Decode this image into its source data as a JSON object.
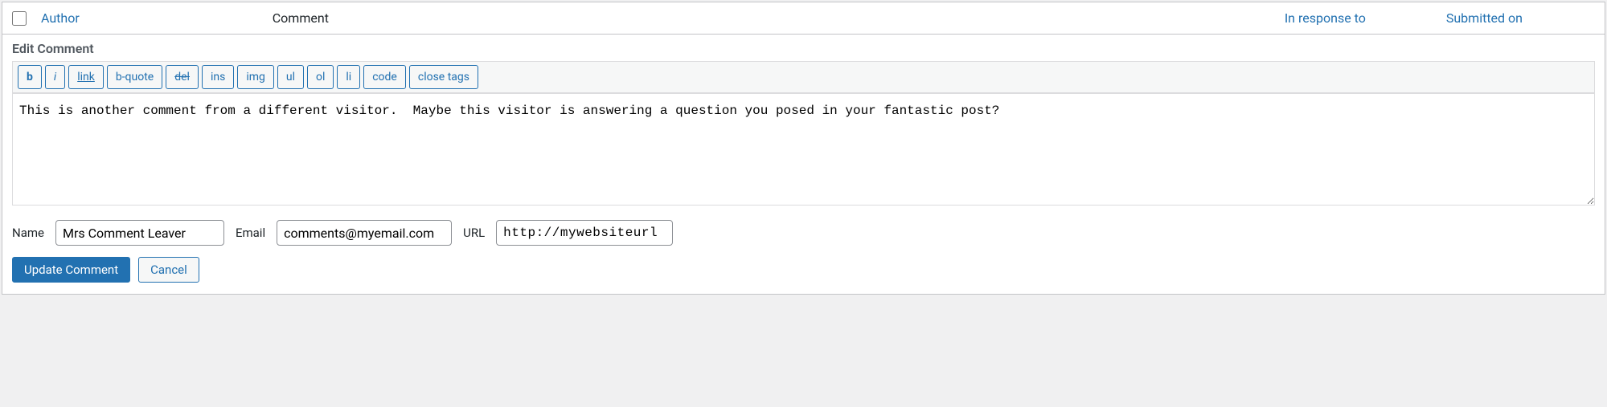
{
  "header": {
    "author": "Author",
    "comment": "Comment",
    "in_response_to": "In response to",
    "submitted_on": "Submitted on"
  },
  "editor": {
    "title": "Edit Comment",
    "quicktags": {
      "b": "b",
      "i": "i",
      "link": "link",
      "bquote": "b-quote",
      "del": "del",
      "ins": "ins",
      "img": "img",
      "ul": "ul",
      "ol": "ol",
      "li": "li",
      "code": "code",
      "close": "close tags"
    },
    "content": "This is another comment from a different visitor.  Maybe this visitor is answering a question you posed in your fantastic post?"
  },
  "fields": {
    "name_label": "Name",
    "name_value": "Mrs Comment Leaver",
    "email_label": "Email",
    "email_value": "comments@myemail.com",
    "url_label": "URL",
    "url_value": "http://mywebsiteurl"
  },
  "actions": {
    "update": "Update Comment",
    "cancel": "Cancel"
  }
}
